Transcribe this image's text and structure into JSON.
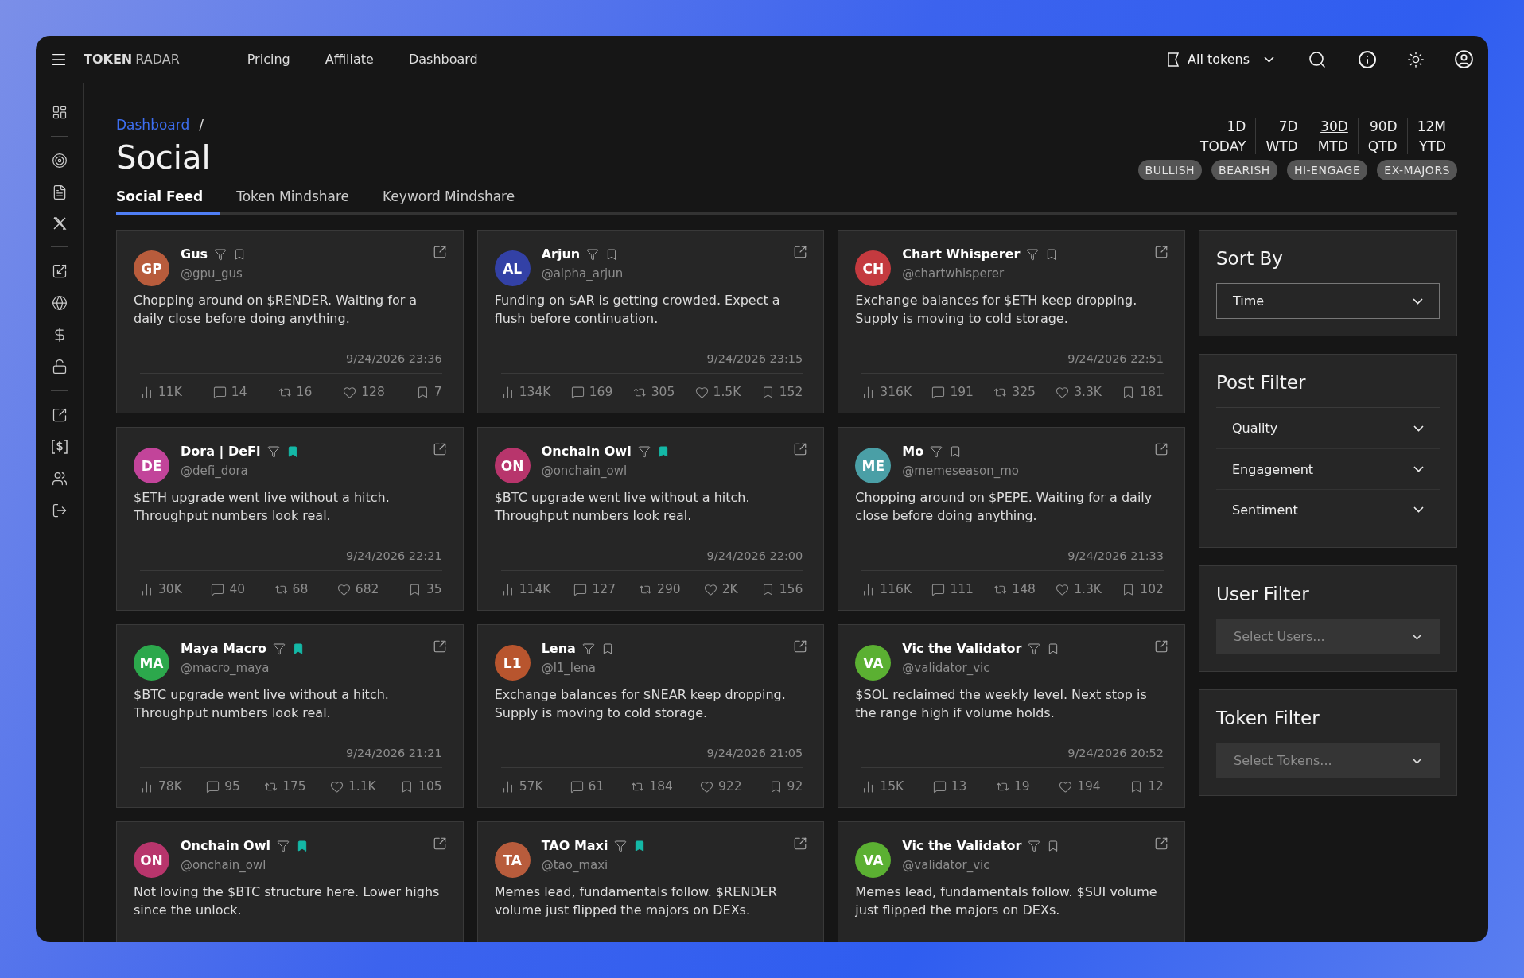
{
  "topbar": {
    "brand": {
      "strong": "TOKEN",
      "light": "RADAR"
    },
    "nav": [
      "Pricing",
      "Affiliate",
      "Dashboard"
    ],
    "token_select": "All tokens"
  },
  "breadcrumb": "Dashboard",
  "breadcrumb_separator": "/",
  "title": "Social",
  "tabs": [
    {
      "label": "Social Feed",
      "selected": true
    },
    {
      "label": "Token Mindshare",
      "selected": false
    },
    {
      "label": "Keyword Mindshare",
      "selected": false
    }
  ],
  "ranges": [
    {
      "top": "1D",
      "bottom": "TODAY",
      "selected": false
    },
    {
      "top": "7D",
      "bottom": "WTD",
      "selected": false
    },
    {
      "top": "30D",
      "bottom": "MTD",
      "selected": true
    },
    {
      "top": "90D",
      "bottom": "QTD",
      "selected": false
    },
    {
      "top": "12M",
      "bottom": "YTD",
      "selected": false
    }
  ],
  "chips": [
    "BULLISH",
    "BEARISH",
    "HI-ENGAGE",
    "EX-MAJORS"
  ],
  "posts": [
    {
      "initials": "GP",
      "color": "#b85c3c",
      "name": "Gus",
      "handle": "@gpu_gus",
      "bookmarked": false,
      "text": "Chopping around on $RENDER. Waiting for a daily close before doing anything.",
      "date": "9/24/2026 23:36",
      "stats": {
        "views": "11K",
        "replies": "14",
        "reposts": "16",
        "likes": "128",
        "saves": "7"
      }
    },
    {
      "initials": "AL",
      "color": "#3341a6",
      "name": "Arjun",
      "handle": "@alpha_arjun",
      "bookmarked": false,
      "text": "Funding on $AR is getting crowded. Expect a flush before continuation.",
      "date": "9/24/2026 23:15",
      "stats": {
        "views": "134K",
        "replies": "169",
        "reposts": "305",
        "likes": "1.5K",
        "saves": "152"
      }
    },
    {
      "initials": "CH",
      "color": "#c43a3f",
      "name": "Chart Whisperer",
      "handle": "@chartwhisperer",
      "bookmarked": false,
      "text": "Exchange balances for $ETH keep dropping. Supply is moving to cold storage.",
      "date": "9/24/2026 22:51",
      "stats": {
        "views": "316K",
        "replies": "191",
        "reposts": "325",
        "likes": "3.3K",
        "saves": "181"
      }
    },
    {
      "initials": "DE",
      "color": "#c2449a",
      "name": "Dora | DeFi",
      "handle": "@defi_dora",
      "bookmarked": true,
      "text": "$ETH upgrade went live without a hitch. Throughput numbers look real.",
      "date": "9/24/2026 22:21",
      "stats": {
        "views": "30K",
        "replies": "40",
        "reposts": "68",
        "likes": "682",
        "saves": "35"
      }
    },
    {
      "initials": "ON",
      "color": "#b8356c",
      "name": "Onchain Owl",
      "handle": "@onchain_owl",
      "bookmarked": true,
      "text": "$BTC upgrade went live without a hitch. Throughput numbers look real.",
      "date": "9/24/2026 22:00",
      "stats": {
        "views": "114K",
        "replies": "127",
        "reposts": "290",
        "likes": "2K",
        "saves": "156"
      }
    },
    {
      "initials": "ME",
      "color": "#4a9fa6",
      "name": "Mo",
      "handle": "@memeseason_mo",
      "bookmarked": false,
      "text": "Chopping around on $PEPE. Waiting for a daily close before doing anything.",
      "date": "9/24/2026 21:33",
      "stats": {
        "views": "116K",
        "replies": "111",
        "reposts": "148",
        "likes": "1.3K",
        "saves": "102"
      }
    },
    {
      "initials": "MA",
      "color": "#2ca84c",
      "name": "Maya Macro",
      "handle": "@macro_maya",
      "bookmarked": true,
      "text": "$BTC upgrade went live without a hitch. Throughput numbers look real.",
      "date": "9/24/2026 21:21",
      "stats": {
        "views": "78K",
        "replies": "95",
        "reposts": "175",
        "likes": "1.1K",
        "saves": "105"
      }
    },
    {
      "initials": "L1",
      "color": "#b8552e",
      "name": "Lena",
      "handle": "@l1_lena",
      "bookmarked": false,
      "text": "Exchange balances for $NEAR keep dropping. Supply is moving to cold storage.",
      "date": "9/24/2026 21:05",
      "stats": {
        "views": "57K",
        "replies": "61",
        "reposts": "184",
        "likes": "922",
        "saves": "92"
      }
    },
    {
      "initials": "VA",
      "color": "#5bb032",
      "name": "Vic the Validator",
      "handle": "@validator_vic",
      "bookmarked": false,
      "text": "$SOL reclaimed the weekly level. Next stop is the range high if volume holds.",
      "date": "9/24/2026 20:52",
      "stats": {
        "views": "15K",
        "replies": "13",
        "reposts": "19",
        "likes": "194",
        "saves": "12"
      }
    },
    {
      "initials": "ON",
      "color": "#b8356c",
      "name": "Onchain Owl",
      "handle": "@onchain_owl",
      "bookmarked": true,
      "text": "Not loving the $BTC structure here. Lower highs since the unlock."
    },
    {
      "initials": "TA",
      "color": "#b85c3c",
      "name": "TAO Maxi",
      "handle": "@tao_maxi",
      "bookmarked": true,
      "text": "Memes lead, fundamentals follow. $RENDER volume just flipped the majors on DEXs."
    },
    {
      "initials": "VA",
      "color": "#5bb032",
      "name": "Vic the Validator",
      "handle": "@validator_vic",
      "bookmarked": false,
      "text": "Memes lead, fundamentals follow. $SUI volume just flipped the majors on DEXs."
    }
  ],
  "sort_by": {
    "title": "Sort By",
    "value": "Time"
  },
  "post_filter": {
    "title": "Post Filter",
    "items": [
      "Quality",
      "Engagement",
      "Sentiment"
    ]
  },
  "user_filter": {
    "title": "User Filter",
    "placeholder": "Select Users..."
  },
  "token_filter": {
    "title": "Token Filter",
    "placeholder": "Select Tokens..."
  }
}
